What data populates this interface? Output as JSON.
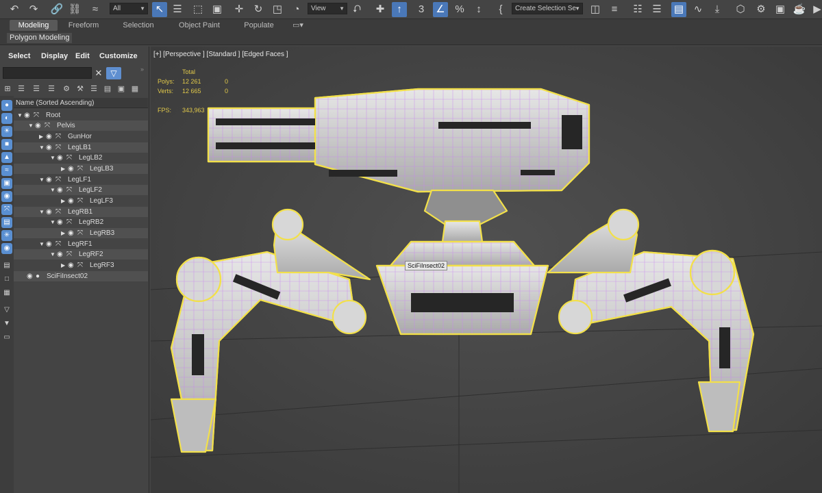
{
  "toolbar": {
    "selection_filter": "All",
    "ref_coord": "View",
    "named_selection": "Create Selection Se"
  },
  "ribbon": {
    "tabs": [
      "Modeling",
      "Freeform",
      "Selection",
      "Object Paint",
      "Populate"
    ],
    "panel_label": "Polygon Modeling"
  },
  "explorer": {
    "menu": [
      "Select",
      "Display",
      "Edit",
      "Customize"
    ],
    "column_header": "Name (Sorted Ascending)",
    "tree": [
      {
        "name": "Root"
      },
      {
        "name": "Pelvis"
      },
      {
        "name": "GunHor"
      },
      {
        "name": "LegLB1"
      },
      {
        "name": "LegLB2"
      },
      {
        "name": "LegLB3"
      },
      {
        "name": "LegLF1"
      },
      {
        "name": "LegLF2"
      },
      {
        "name": "LegLF3"
      },
      {
        "name": "LegRB1"
      },
      {
        "name": "LegRB2"
      },
      {
        "name": "LegRB3"
      },
      {
        "name": "LegRF1"
      },
      {
        "name": "LegRF2"
      },
      {
        "name": "LegRF3"
      },
      {
        "name": "SciFiInsect02"
      }
    ]
  },
  "viewport": {
    "label": "[+] [Perspective ] [Standard ] [Edged Faces ]",
    "stats": {
      "total_label": "Total",
      "polys_label": "Polys:",
      "polys_total": "12 261",
      "polys_sel": "0",
      "verts_label": "Verts:",
      "verts_total": "12 665",
      "verts_sel": "0",
      "fps_label": "FPS:",
      "fps_value": "343,963"
    },
    "tooltip": "SciFiInsect02"
  },
  "colors": {
    "accent_blue": "#4a78b8",
    "stats_yellow": "#e0c84a",
    "selection_outline": "#f2e04a",
    "wire_color": "#d58cff"
  }
}
